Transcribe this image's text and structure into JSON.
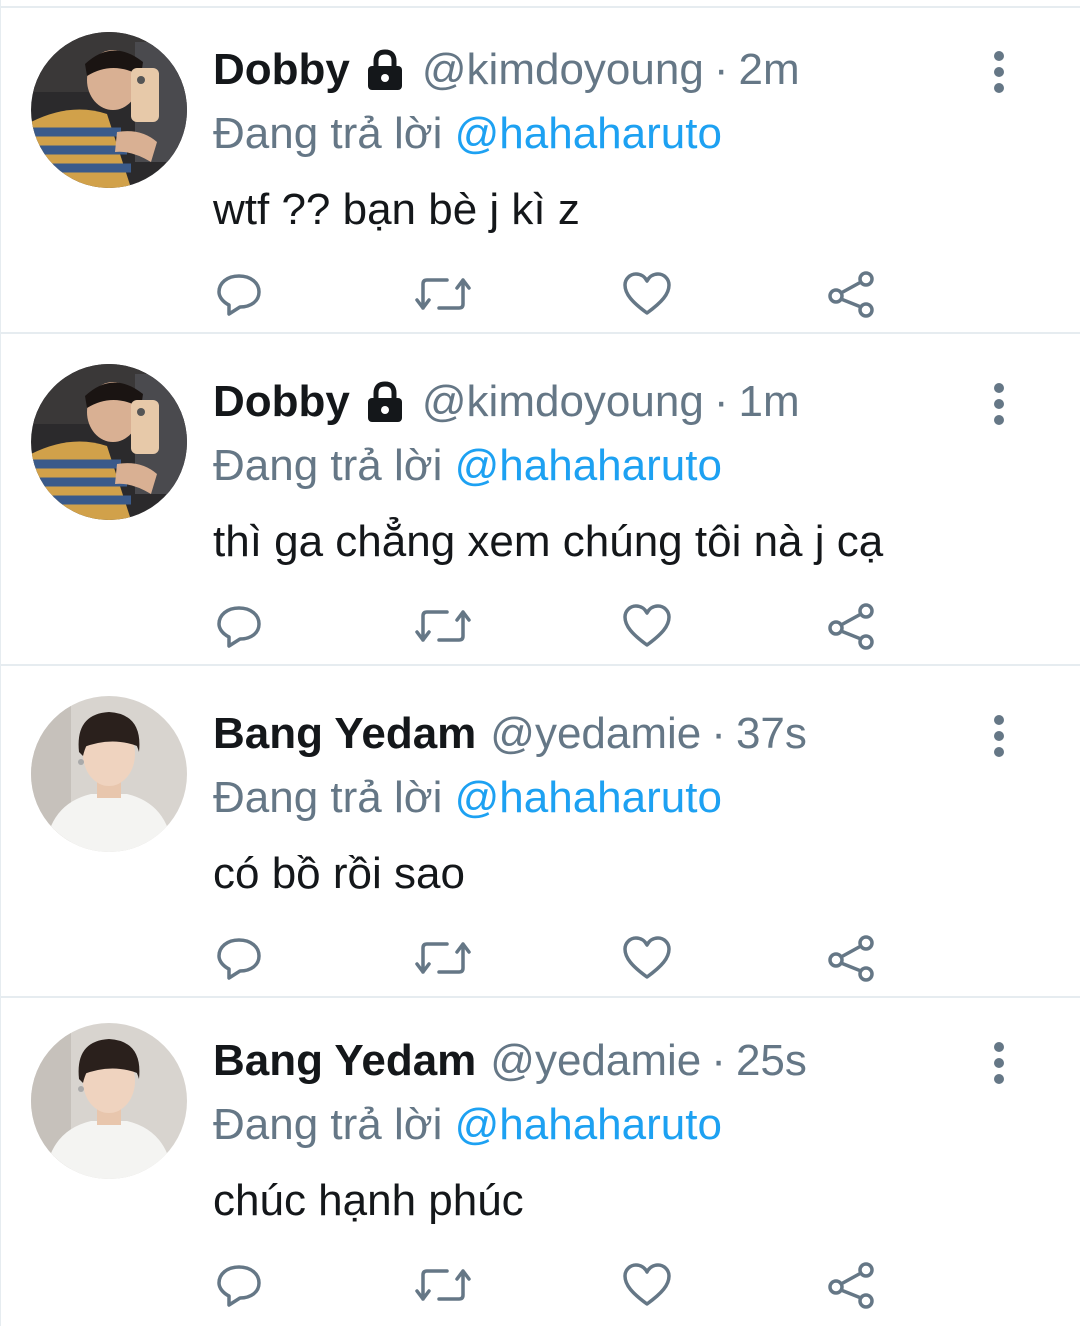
{
  "colors": {
    "primary_text": "#14171a",
    "secondary_text": "#657786",
    "accent": "#1da1f2",
    "divider": "#e6ecf0"
  },
  "icons": {
    "lock": "lock-icon",
    "more": "more-vertical-icon",
    "reply": "reply-icon",
    "retweet": "retweet-icon",
    "like": "heart-icon",
    "share": "share-icon"
  },
  "tweets": [
    {
      "display_name": "Dobby",
      "protected": true,
      "handle": "@kimdoyoung",
      "separator": "·",
      "time": "2m",
      "reply_prefix": "Đang trả lời",
      "reply_mention": "@hahaharuto",
      "text": "wtf ?? bạn bè j kì z",
      "avatar": "avatar-dobby"
    },
    {
      "display_name": "Dobby",
      "protected": true,
      "handle": "@kimdoyoung",
      "separator": "·",
      "time": "1m",
      "reply_prefix": "Đang trả lời",
      "reply_mention": "@hahaharuto",
      "text": "thì ga chẳng xem chúng tôi nà j cạ",
      "avatar": "avatar-dobby"
    },
    {
      "display_name": "Bang Yedam",
      "protected": false,
      "handle": "@yedamie",
      "separator": "·",
      "time": "37s",
      "reply_prefix": "Đang trả lời",
      "reply_mention": "@hahaharuto",
      "text": "có bồ rồi sao",
      "avatar": "avatar-yedam"
    },
    {
      "display_name": "Bang Yedam",
      "protected": false,
      "handle": "@yedamie",
      "separator": "·",
      "time": "25s",
      "reply_prefix": "Đang trả lời",
      "reply_mention": "@hahaharuto",
      "text": "chúc hạnh phúc",
      "avatar": "avatar-yedam"
    }
  ]
}
